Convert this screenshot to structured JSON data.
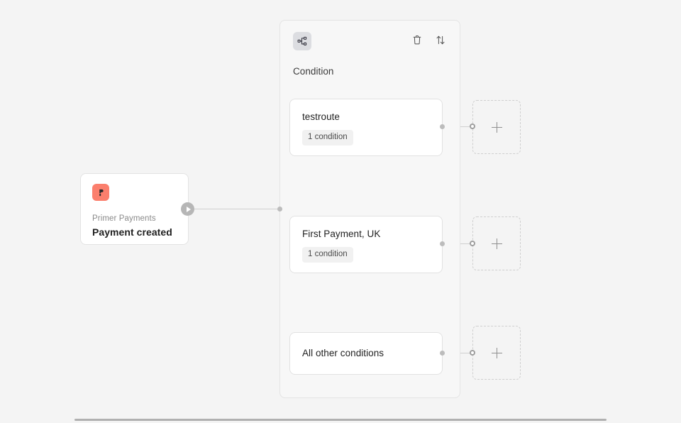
{
  "canvas": {
    "background_color": "#f4f4f4"
  },
  "trigger_node": {
    "name": "Primer Payments",
    "title": "Payment created",
    "logo_icon": "primer-logo-icon",
    "logo_color": "#fb7f6d",
    "run_handle_icon": "play-icon"
  },
  "condition_group": {
    "icon": "branch-condition-icon",
    "title": "Condition",
    "actions": [
      {
        "icon": "trash-icon",
        "name": "delete-condition-button"
      },
      {
        "icon": "sort-arrows-icon",
        "name": "reorder-condition-button"
      }
    ],
    "branches": [
      {
        "label": "testroute",
        "badge": "1 condition"
      },
      {
        "label": "First Payment, UK",
        "badge": "1 condition"
      },
      {
        "label": "All other conditions",
        "badge": null
      }
    ]
  },
  "add_nodes": [
    {
      "icon": "plus-icon",
      "label": ""
    },
    {
      "icon": "plus-icon",
      "label": ""
    },
    {
      "icon": "plus-icon",
      "label": ""
    }
  ],
  "scrollbar": {
    "orientation": "horizontal",
    "thumb_color": "#b0b0b0"
  }
}
